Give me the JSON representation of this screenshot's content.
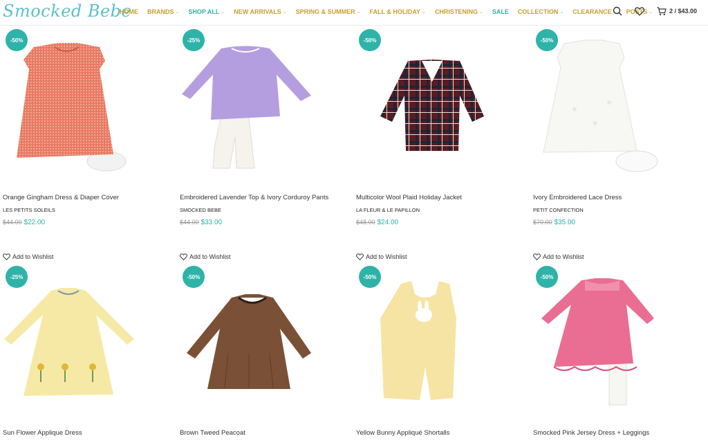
{
  "site": {
    "logo": "Smocked Bebe"
  },
  "nav": [
    {
      "label": "HOME",
      "color": "gold",
      "chevron": false
    },
    {
      "label": "BRANDS",
      "color": "gold",
      "chevron": true
    },
    {
      "label": "SHOP ALL",
      "color": "teal",
      "chevron": true
    },
    {
      "label": "NEW ARRIVALS",
      "color": "gold",
      "chevron": true
    },
    {
      "label": "SPRING & SUMMER",
      "color": "gold",
      "chevron": true
    },
    {
      "label": "FALL & HOLIDAY",
      "color": "gold",
      "chevron": true
    },
    {
      "label": "CHRISTENING",
      "color": "gold",
      "chevron": true
    },
    {
      "label": "SALE",
      "color": "teal",
      "chevron": false
    },
    {
      "label": "COLLECTION",
      "color": "gold",
      "chevron": true
    },
    {
      "label": "CLEARANCE",
      "color": "gold",
      "chevron": true
    },
    {
      "label": "POSTS",
      "color": "gold",
      "chevron": true
    }
  ],
  "header": {
    "cart_text": "2 / $43.00",
    "icons": [
      "search-icon",
      "heart-icon",
      "cart-icon"
    ]
  },
  "colors": {
    "teal": "#2fb3a9",
    "gold": "#c9a02c"
  },
  "wishlist_label": "Add to Wishlist",
  "products": [
    {
      "badge": "-50%",
      "name": "Orange Gingham Dress & Diaper Cover",
      "brand": "LES PETITS SOLEILS",
      "old_price": "$44.00",
      "price": "$22.00"
    },
    {
      "badge": "-25%",
      "name": "Embroidered Lavender Top & Ivory Corduroy Pants",
      "brand": "SMOCKED BEBE",
      "old_price": "$44.00",
      "price": "$33.00"
    },
    {
      "badge": "-50%",
      "name": "Multicolor Wool Plaid Holiday Jacket",
      "brand": "LA FLEUR & LE PAPILLON",
      "old_price": "$48.00",
      "price": "$24.00"
    },
    {
      "badge": "-50%",
      "name": "Ivory Embroidered Lace Dress",
      "brand": "PETIT CONFECTION",
      "old_price": "$70.00",
      "price": "$35.00"
    },
    {
      "badge": "-25%",
      "name": "Sun Flower Applique Dress"
    },
    {
      "badge": "-50%",
      "name": "Brown Tweed Peacoat"
    },
    {
      "badge": "-50%",
      "name": "Yellow Bunny Appliqué Shortalls"
    },
    {
      "badge": "-50%",
      "name": "Smocked Pink Jersey Dress + Leggings"
    }
  ]
}
